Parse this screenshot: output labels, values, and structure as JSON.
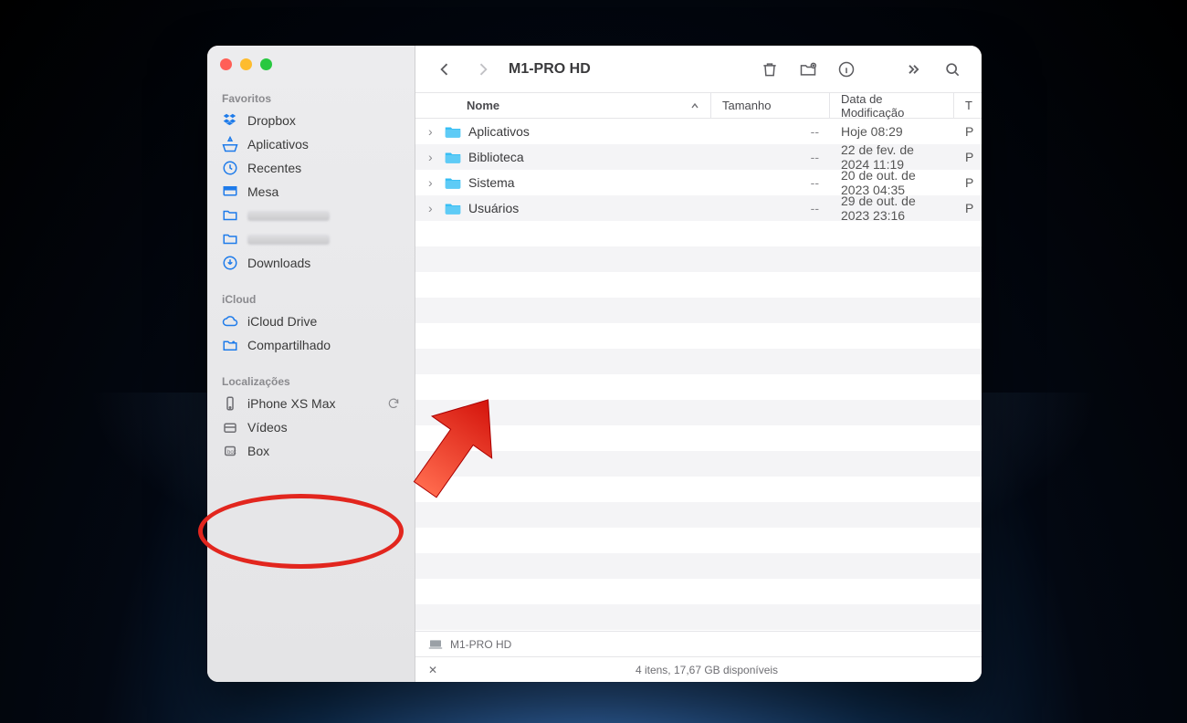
{
  "window": {
    "title": "M1-PRO HD"
  },
  "sidebar": {
    "sections": [
      {
        "label": "Favoritos",
        "items": [
          {
            "icon": "dropbox-icon",
            "label": "Dropbox"
          },
          {
            "icon": "apps-icon",
            "label": "Aplicativos"
          },
          {
            "icon": "recents-icon",
            "label": "Recentes"
          },
          {
            "icon": "desktop-icon",
            "label": "Mesa"
          },
          {
            "icon": "folder-icon",
            "label": "",
            "redacted": true
          },
          {
            "icon": "folder-icon",
            "label": "",
            "redacted": true
          },
          {
            "icon": "downloads-icon",
            "label": "Downloads"
          }
        ]
      },
      {
        "label": "iCloud",
        "items": [
          {
            "icon": "cloud-icon",
            "label": "iCloud Drive"
          },
          {
            "icon": "shared-icon",
            "label": "Compartilhado"
          }
        ]
      },
      {
        "label": "Localizações",
        "items": [
          {
            "icon": "iphone-icon",
            "label": "iPhone XS Max",
            "syncing": true
          },
          {
            "icon": "disk-icon",
            "label": "Vídeos"
          },
          {
            "icon": "box-icon",
            "label": "Box"
          }
        ]
      }
    ]
  },
  "columns": {
    "name": "Nome",
    "size": "Tamanho",
    "date": "Data de Modificação",
    "last": "T"
  },
  "files": [
    {
      "name": "Aplicativos",
      "size": "--",
      "date": "Hoje 08:29",
      "kind": "P"
    },
    {
      "name": "Biblioteca",
      "size": "--",
      "date": "22 de fev. de 2024 11:19",
      "kind": "P"
    },
    {
      "name": "Sistema",
      "size": "--",
      "date": "20 de out. de 2023 04:35",
      "kind": "P"
    },
    {
      "name": "Usuários",
      "size": "--",
      "date": "29 de out. de 2023 23:16",
      "kind": "P"
    }
  ],
  "pathbar": {
    "location": "M1-PRO HD"
  },
  "statusbar": {
    "text": "4 itens, 17,67 GB disponíveis"
  }
}
